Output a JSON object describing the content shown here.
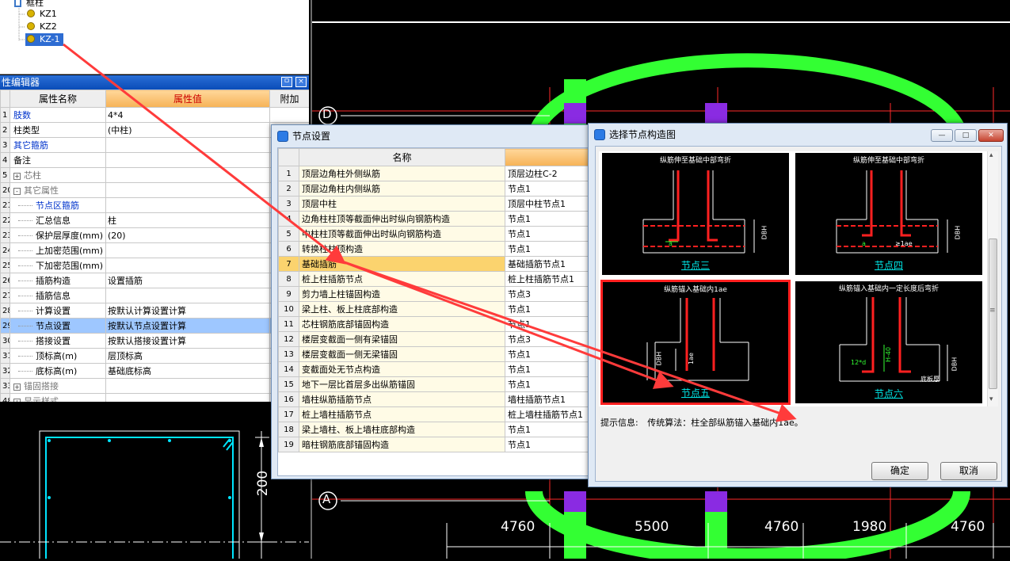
{
  "tree": {
    "parent": "框柱",
    "items": [
      "KZ1",
      "KZ2",
      "KZ-1"
    ],
    "selected_index": 2
  },
  "prop_panel": {
    "title": "性编辑器",
    "pin_glyph": "ㅁ",
    "close_glyph": "×",
    "headers": {
      "name": "属性名称",
      "value": "属性值",
      "extra": "附加"
    },
    "rows": [
      {
        "num": "1",
        "name": "肢数",
        "value": "4*4",
        "style": "blue",
        "indent": 0
      },
      {
        "num": "2",
        "name": "柱类型",
        "value": "(中柱)",
        "style": "normal",
        "indent": 0
      },
      {
        "num": "3",
        "name": "其它箍筋",
        "value": "",
        "style": "blue",
        "indent": 0
      },
      {
        "num": "4",
        "name": "备注",
        "value": "",
        "style": "normal",
        "indent": 0
      },
      {
        "num": "5",
        "name": "芯柱",
        "value": "",
        "style": "gray",
        "indent": 0,
        "expander": "+"
      },
      {
        "num": "20",
        "name": "其它属性",
        "value": "",
        "style": "gray",
        "indent": 0,
        "expander": "-"
      },
      {
        "num": "21",
        "name": "节点区箍筋",
        "value": "",
        "style": "blue",
        "indent": 1
      },
      {
        "num": "22",
        "name": "汇总信息",
        "value": "柱",
        "style": "normal",
        "indent": 1
      },
      {
        "num": "23",
        "name": "保护层厚度(mm)",
        "value": "(20)",
        "style": "normal",
        "indent": 1
      },
      {
        "num": "24",
        "name": "上加密范围(mm)",
        "value": "",
        "style": "normal",
        "indent": 1
      },
      {
        "num": "25",
        "name": "下加密范围(mm)",
        "value": "",
        "style": "normal",
        "indent": 1
      },
      {
        "num": "26",
        "name": "插筋构造",
        "value": "设置插筋",
        "style": "normal",
        "indent": 1
      },
      {
        "num": "27",
        "name": "插筋信息",
        "value": "",
        "style": "normal",
        "indent": 1
      },
      {
        "num": "28",
        "name": "计算设置",
        "value": "按默认计算设置计算",
        "style": "normal",
        "indent": 1
      },
      {
        "num": "29",
        "name": "节点设置",
        "value": "按默认节点设置计算",
        "style": "normal",
        "indent": 1,
        "selected": true
      },
      {
        "num": "30",
        "name": "搭接设置",
        "value": "按默认搭接设置计算",
        "style": "normal",
        "indent": 1
      },
      {
        "num": "31",
        "name": "顶标高(m)",
        "value": "层顶标高",
        "style": "normal",
        "indent": 1
      },
      {
        "num": "32",
        "name": "底标高(m)",
        "value": "基础底标高",
        "style": "normal",
        "indent": 1
      },
      {
        "num": "33",
        "name": "锚固搭接",
        "value": "",
        "style": "gray",
        "indent": 0,
        "expander": "+"
      },
      {
        "num": "48",
        "name": "显示样式",
        "value": "",
        "style": "gray",
        "indent": 0,
        "expander": "+"
      }
    ]
  },
  "node_settings": {
    "title": "节点设置",
    "header": "名称",
    "rows": [
      {
        "num": "1",
        "name": "顶层边角柱外侧纵筋",
        "value": "顶层边柱C-2"
      },
      {
        "num": "2",
        "name": "顶层边角柱内侧纵筋",
        "value": "节点1"
      },
      {
        "num": "3",
        "name": "顶层中柱",
        "value": "顶层中柱节点1"
      },
      {
        "num": "4",
        "name": "边角柱柱顶等截面伸出时纵向钢筋构造",
        "value": "节点1"
      },
      {
        "num": "5",
        "name": "中柱柱顶等截面伸出时纵向钢筋构造",
        "value": "节点1"
      },
      {
        "num": "6",
        "name": "转换柱柱顶构造",
        "value": "节点1"
      },
      {
        "num": "7",
        "name": "基础插筋",
        "value": "基础插筋节点1",
        "selected": true
      },
      {
        "num": "8",
        "name": "桩上柱插筋节点",
        "value": "桩上柱插筋节点1"
      },
      {
        "num": "9",
        "name": "剪力墙上柱锚固构造",
        "value": "节点3"
      },
      {
        "num": "10",
        "name": "梁上柱、板上柱底部构造",
        "value": "节点1"
      },
      {
        "num": "11",
        "name": "芯柱钢筋底部锚固构造",
        "value": "节点1"
      },
      {
        "num": "12",
        "name": "楼层变截面一侧有梁锚固",
        "value": "节点3"
      },
      {
        "num": "13",
        "name": "楼层变截面一侧无梁锚固",
        "value": "节点1"
      },
      {
        "num": "14",
        "name": "变截面处无节点构造",
        "value": "节点1"
      },
      {
        "num": "15",
        "name": "地下一层比首层多出纵筋锚固",
        "value": "节点1"
      },
      {
        "num": "16",
        "name": "墙柱纵筋插筋节点",
        "value": "墙柱插筋节点1"
      },
      {
        "num": "17",
        "name": "桩上墙柱插筋节点",
        "value": "桩上墙柱插筋节点1"
      },
      {
        "num": "18",
        "name": "梁上墙柱、板上墙柱底部构造",
        "value": "节点1"
      },
      {
        "num": "19",
        "name": "暗柱钢筋底部锚固构造",
        "value": "节点1"
      }
    ]
  },
  "pick_dialog": {
    "title": "选择节点构造图",
    "tiles": [
      {
        "caption": "纵筋伸至基础中部弯折",
        "label": "节点三",
        "dim_a": "a",
        "dim_h": "DBH"
      },
      {
        "caption": "纵筋伸至基础中部弯折",
        "label": "节点四",
        "dim_a": "a",
        "dim_note": "≥1ae",
        "dim_h": "DBH"
      },
      {
        "caption": "纵筋锚入基础内1ae",
        "label": "节点五",
        "dim_h": "DBH",
        "dim_l": "1ae",
        "selected": true
      },
      {
        "caption": "纵筋锚入基础内一定长度后弯折",
        "label": "节点六",
        "dim_d": "12*d",
        "dim_h": "H-40",
        "dim_b": "底板厚",
        "dim_n": "DBH"
      }
    ],
    "hint_label": "提示信息:",
    "hint_text": "传统算法：柱全部纵筋锚入基础内1ae。",
    "ok": "确定",
    "cancel": "取消",
    "scroll_arrow_up": "▴",
    "scroll_arrow_down": "▾",
    "scroll_grip": "≡",
    "win_min": "—",
    "win_max": "□",
    "win_close": "✕"
  },
  "cad": {
    "axis_d": "D",
    "axis_a": "A",
    "dims": [
      "4760",
      "5500",
      "4760",
      "1980",
      "4760"
    ],
    "section_dim": "200"
  },
  "colors": {
    "accent": "#0a4cb8",
    "arrow": "#ff3b3b",
    "cad_ring": "#33ff33",
    "cad_column": "#8a2be2",
    "rebar": "#ff2020"
  }
}
